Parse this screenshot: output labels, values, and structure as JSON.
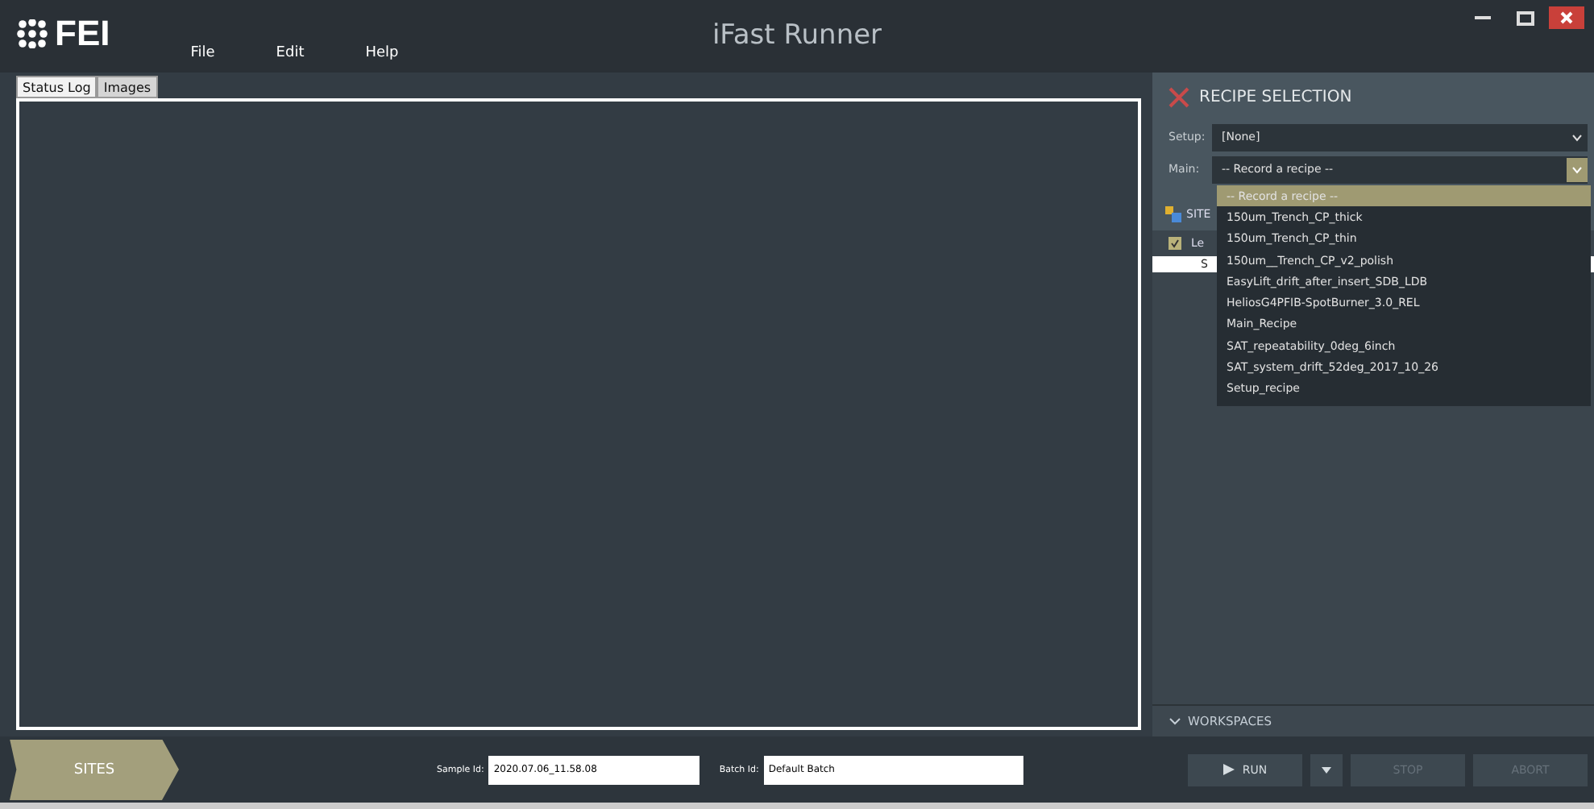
{
  "window": {
    "logo": "FEI",
    "title": "iFast Runner",
    "menu": [
      "File",
      "Edit",
      "Help"
    ]
  },
  "tabs": [
    {
      "label": "Status Log",
      "selected": true
    },
    {
      "label": "Images",
      "selected": false
    }
  ],
  "recipe_selection": {
    "title": "RECIPE SELECTION",
    "setup_label": "Setup:",
    "setup_value": "[None]",
    "main_label": "Main:",
    "main_value": "-- Record a recipe --",
    "options": [
      {
        "label": "-- Record a recipe --",
        "selected": true
      },
      {
        "label": "150um_Trench_CP_thick",
        "selected": false
      },
      {
        "label": "150um_Trench_CP_thin",
        "selected": false
      },
      {
        "label": "150um__Trench_CP_v2_polish",
        "selected": false
      },
      {
        "label": "EasyLift_drift_after_insert_SDB_LDB",
        "selected": false
      },
      {
        "label": "HeliosG4PFIB-SpotBurner_3.0_REL",
        "selected": false
      },
      {
        "label": "Main_Recipe",
        "selected": false
      },
      {
        "label": "SAT_repeatability_0deg_6inch",
        "selected": false
      },
      {
        "label": "SAT_system_drift_52deg_2017_10_26",
        "selected": false
      },
      {
        "label": "Setup_recipe",
        "selected": false
      }
    ]
  },
  "sites": {
    "title": "SITE",
    "row_label": "Le",
    "checked": true,
    "cell": "S"
  },
  "workspaces": {
    "label": "WORKSPACES"
  },
  "bottom": {
    "sites_button": "SITES",
    "sample_label": "Sample Id:",
    "sample_value": "2020.07.06_11.58.08",
    "batch_label": "Batch Id:",
    "batch_value": "Default Batch",
    "buttons": [
      {
        "label": "RUN",
        "disabled": false
      },
      {
        "label": "STOP",
        "disabled": true
      },
      {
        "label": "ABORT",
        "disabled": true
      }
    ]
  }
}
